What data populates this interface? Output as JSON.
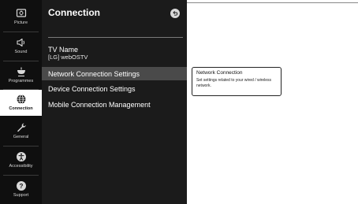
{
  "sidebar": {
    "items": [
      {
        "label": "Picture",
        "icon": "picture-icon",
        "active": false
      },
      {
        "label": "Sound",
        "icon": "speaker-icon",
        "active": false
      },
      {
        "label": "Programmes",
        "icon": "antenna-icon",
        "active": false
      },
      {
        "label": "Connection",
        "icon": "globe-icon",
        "active": true
      },
      {
        "label": "General",
        "icon": "wrench-icon",
        "active": false
      },
      {
        "label": "Accessibility",
        "icon": "accessibility-icon",
        "active": false
      },
      {
        "label": "Support",
        "icon": "support-icon",
        "active": false
      }
    ]
  },
  "panel": {
    "title": "Connection",
    "back_icon": "back-icon",
    "tv_name_label": "TV Name",
    "tv_name_value": "[LG] webOSTV",
    "menu": [
      {
        "label": "Network Connection Settings",
        "focused": true
      },
      {
        "label": "Device Connection Settings",
        "focused": false
      },
      {
        "label": "Mobile Connection Management",
        "focused": false
      }
    ]
  },
  "tooltip": {
    "title": "Network Connection",
    "description": "Set settings related to your wired / wireless network."
  },
  "colors": {
    "rail_bg": "#0f0f0f",
    "panel_bg": "#1b1b1b",
    "focus_bg": "#4a4a4a",
    "active_tab_bg": "#ffffff"
  }
}
